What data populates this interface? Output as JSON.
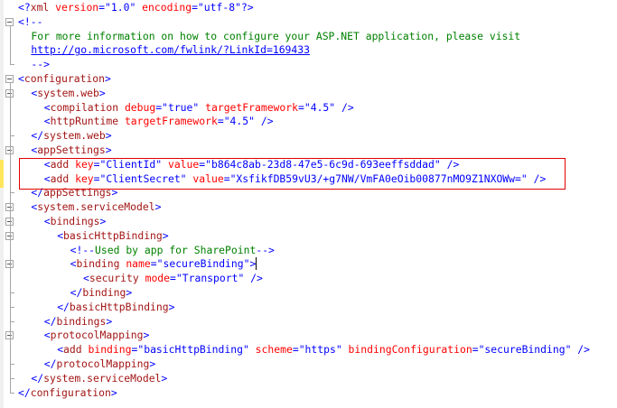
{
  "editor": {
    "language": "XML",
    "highlight_color": "#e00000",
    "change_marker_color": "#ffe65c",
    "lines": [
      {
        "indent": 0,
        "segs": [
          [
            "t",
            "<?"
          ],
          [
            "n",
            "xml"
          ],
          [
            "a",
            " version"
          ],
          [
            "t",
            "="
          ],
          [
            "t",
            "\"1.0\""
          ],
          [
            "a",
            " encoding"
          ],
          [
            "t",
            "="
          ],
          [
            "t",
            "\"utf-8\""
          ],
          [
            "t",
            "?>"
          ]
        ]
      },
      {
        "indent": 0,
        "segs": [
          [
            "t",
            "<!--"
          ]
        ]
      },
      {
        "indent": 1,
        "segs": [
          [
            "c",
            "For more information on how to configure your ASP.NET application, please visit"
          ]
        ]
      },
      {
        "indent": 1,
        "segs": [
          [
            "u",
            "http://go.microsoft.com/fwlink/?LinkId=169433"
          ]
        ]
      },
      {
        "indent": 1,
        "segs": [
          [
            "t",
            "-->"
          ]
        ]
      },
      {
        "indent": 0,
        "segs": [
          [
            "t",
            "<"
          ],
          [
            "n",
            "configuration"
          ],
          [
            "t",
            ">"
          ]
        ]
      },
      {
        "indent": 1,
        "segs": [
          [
            "t",
            "<"
          ],
          [
            "n",
            "system.web"
          ],
          [
            "t",
            ">"
          ]
        ]
      },
      {
        "indent": 2,
        "segs": [
          [
            "t",
            "<"
          ],
          [
            "n",
            "compilation"
          ],
          [
            "a",
            " debug"
          ],
          [
            "t",
            "="
          ],
          [
            "t",
            "\"true\""
          ],
          [
            "a",
            " targetFramework"
          ],
          [
            "t",
            "="
          ],
          [
            "t",
            "\"4.5\""
          ],
          [
            "t",
            " />"
          ]
        ]
      },
      {
        "indent": 2,
        "segs": [
          [
            "t",
            "<"
          ],
          [
            "n",
            "httpRuntime"
          ],
          [
            "a",
            " targetFramework"
          ],
          [
            "t",
            "="
          ],
          [
            "t",
            "\"4.5\""
          ],
          [
            "t",
            " />"
          ]
        ]
      },
      {
        "indent": 1,
        "segs": [
          [
            "t",
            "</"
          ],
          [
            "n",
            "system.web"
          ],
          [
            "t",
            ">"
          ]
        ]
      },
      {
        "indent": 1,
        "segs": [
          [
            "t",
            "<"
          ],
          [
            "n",
            "appSettings"
          ],
          [
            "t",
            ">"
          ]
        ]
      },
      {
        "indent": 2,
        "segs": [
          [
            "t",
            "<"
          ],
          [
            "n",
            "add"
          ],
          [
            "a",
            " key"
          ],
          [
            "t",
            "="
          ],
          [
            "t",
            "\"ClientId\""
          ],
          [
            "a",
            " value"
          ],
          [
            "t",
            "="
          ],
          [
            "t",
            "\"b864c8ab-23d8-47e5-6c9d-693eeffsddad\""
          ],
          [
            "t",
            " />"
          ]
        ]
      },
      {
        "indent": 2,
        "segs": [
          [
            "t",
            "<"
          ],
          [
            "n",
            "add"
          ],
          [
            "a",
            " key"
          ],
          [
            "t",
            "="
          ],
          [
            "t",
            "\"ClientSecret\""
          ],
          [
            "a",
            " value"
          ],
          [
            "t",
            "="
          ],
          [
            "t",
            "\"XsfikfDB59vU3/+g7NW/VmFA0eOib00877nMO9Z1NXOWw=\""
          ],
          [
            "t",
            " />"
          ]
        ]
      },
      {
        "indent": 1,
        "segs": [
          [
            "t",
            "</"
          ],
          [
            "n",
            "appSettings"
          ],
          [
            "t",
            ">"
          ]
        ]
      },
      {
        "indent": 1,
        "segs": [
          [
            "t",
            "<"
          ],
          [
            "n",
            "system.serviceModel"
          ],
          [
            "t",
            ">"
          ]
        ]
      },
      {
        "indent": 2,
        "segs": [
          [
            "t",
            "<"
          ],
          [
            "n",
            "bindings"
          ],
          [
            "t",
            ">"
          ]
        ]
      },
      {
        "indent": 3,
        "segs": [
          [
            "t",
            "<"
          ],
          [
            "n",
            "basicHttpBinding"
          ],
          [
            "t",
            ">"
          ]
        ]
      },
      {
        "indent": 4,
        "segs": [
          [
            "t",
            "<!--"
          ],
          [
            "c",
            "Used by app for SharePoint"
          ],
          [
            "t",
            "-->"
          ]
        ]
      },
      {
        "indent": 4,
        "segs": [
          [
            "t",
            "<"
          ],
          [
            "n",
            "binding"
          ],
          [
            "a",
            " name"
          ],
          [
            "t",
            "="
          ],
          [
            "t",
            "\"secureBinding\""
          ],
          [
            "t",
            ">"
          ]
        ],
        "caret": true
      },
      {
        "indent": 5,
        "segs": [
          [
            "t",
            "<"
          ],
          [
            "n",
            "security"
          ],
          [
            "a",
            " mode"
          ],
          [
            "t",
            "="
          ],
          [
            "t",
            "\"Transport\""
          ],
          [
            "t",
            " />"
          ]
        ]
      },
      {
        "indent": 4,
        "segs": [
          [
            "t",
            "</"
          ],
          [
            "n",
            "binding"
          ],
          [
            "t",
            ">"
          ]
        ]
      },
      {
        "indent": 3,
        "segs": [
          [
            "t",
            "</"
          ],
          [
            "n",
            "basicHttpBinding"
          ],
          [
            "t",
            ">"
          ]
        ]
      },
      {
        "indent": 2,
        "segs": [
          [
            "t",
            "</"
          ],
          [
            "n",
            "bindings"
          ],
          [
            "t",
            ">"
          ]
        ]
      },
      {
        "indent": 2,
        "segs": [
          [
            "t",
            "<"
          ],
          [
            "n",
            "protocolMapping"
          ],
          [
            "t",
            ">"
          ]
        ]
      },
      {
        "indent": 3,
        "segs": [
          [
            "t",
            "<"
          ],
          [
            "n",
            "add"
          ],
          [
            "a",
            " binding"
          ],
          [
            "t",
            "="
          ],
          [
            "t",
            "\"basicHttpBinding\""
          ],
          [
            "a",
            " scheme"
          ],
          [
            "t",
            "="
          ],
          [
            "t",
            "\"https\""
          ],
          [
            "a",
            " bindingConfiguration"
          ],
          [
            "t",
            "="
          ],
          [
            "t",
            "\"secureBinding\""
          ],
          [
            "t",
            " />"
          ]
        ]
      },
      {
        "indent": 2,
        "segs": [
          [
            "t",
            "</"
          ],
          [
            "n",
            "protocolMapping"
          ],
          [
            "t",
            ">"
          ]
        ]
      },
      {
        "indent": 1,
        "segs": [
          [
            "t",
            "</"
          ],
          [
            "n",
            "system.serviceModel"
          ],
          [
            "t",
            ">"
          ]
        ]
      },
      {
        "indent": 0,
        "segs": [
          [
            "t",
            "</"
          ],
          [
            "n",
            "configuration"
          ],
          [
            "t",
            ">"
          ]
        ]
      }
    ]
  }
}
